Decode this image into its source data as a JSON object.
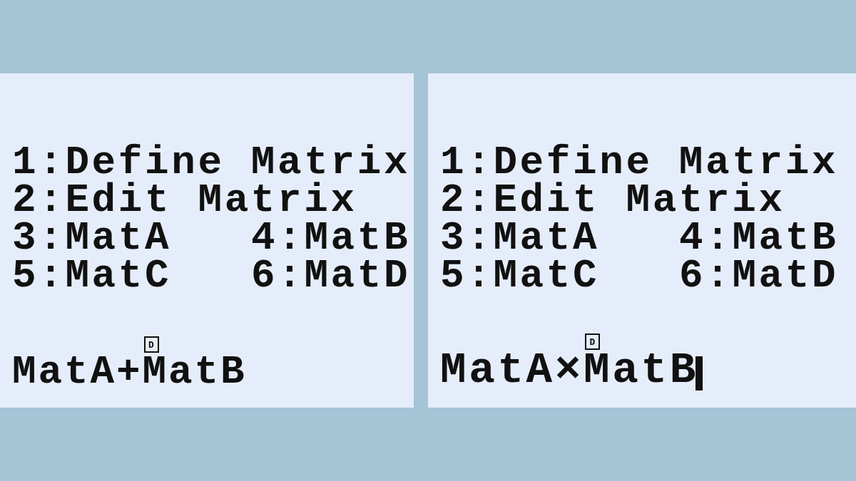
{
  "screens": [
    {
      "menu": {
        "rows": [
          [
            "1:Define Matrix"
          ],
          [
            "2:Edit Matrix"
          ],
          [
            "3:MatA",
            "4:MatB"
          ],
          [
            "5:MatC",
            "6:MatD"
          ]
        ]
      },
      "expression": {
        "parts": [
          {
            "text": "MatA+"
          },
          {
            "text": "MatB",
            "marker": "D"
          }
        ],
        "cursor": false
      }
    },
    {
      "menu": {
        "rows": [
          [
            "1:Define Matrix"
          ],
          [
            "2:Edit Matrix"
          ],
          [
            "3:MatA",
            "4:MatB"
          ],
          [
            "5:MatC",
            "6:MatD"
          ]
        ]
      },
      "expression": {
        "parts": [
          {
            "text": "MatA×"
          },
          {
            "text": "MatB",
            "marker": "D"
          }
        ],
        "cursor": true
      }
    }
  ]
}
